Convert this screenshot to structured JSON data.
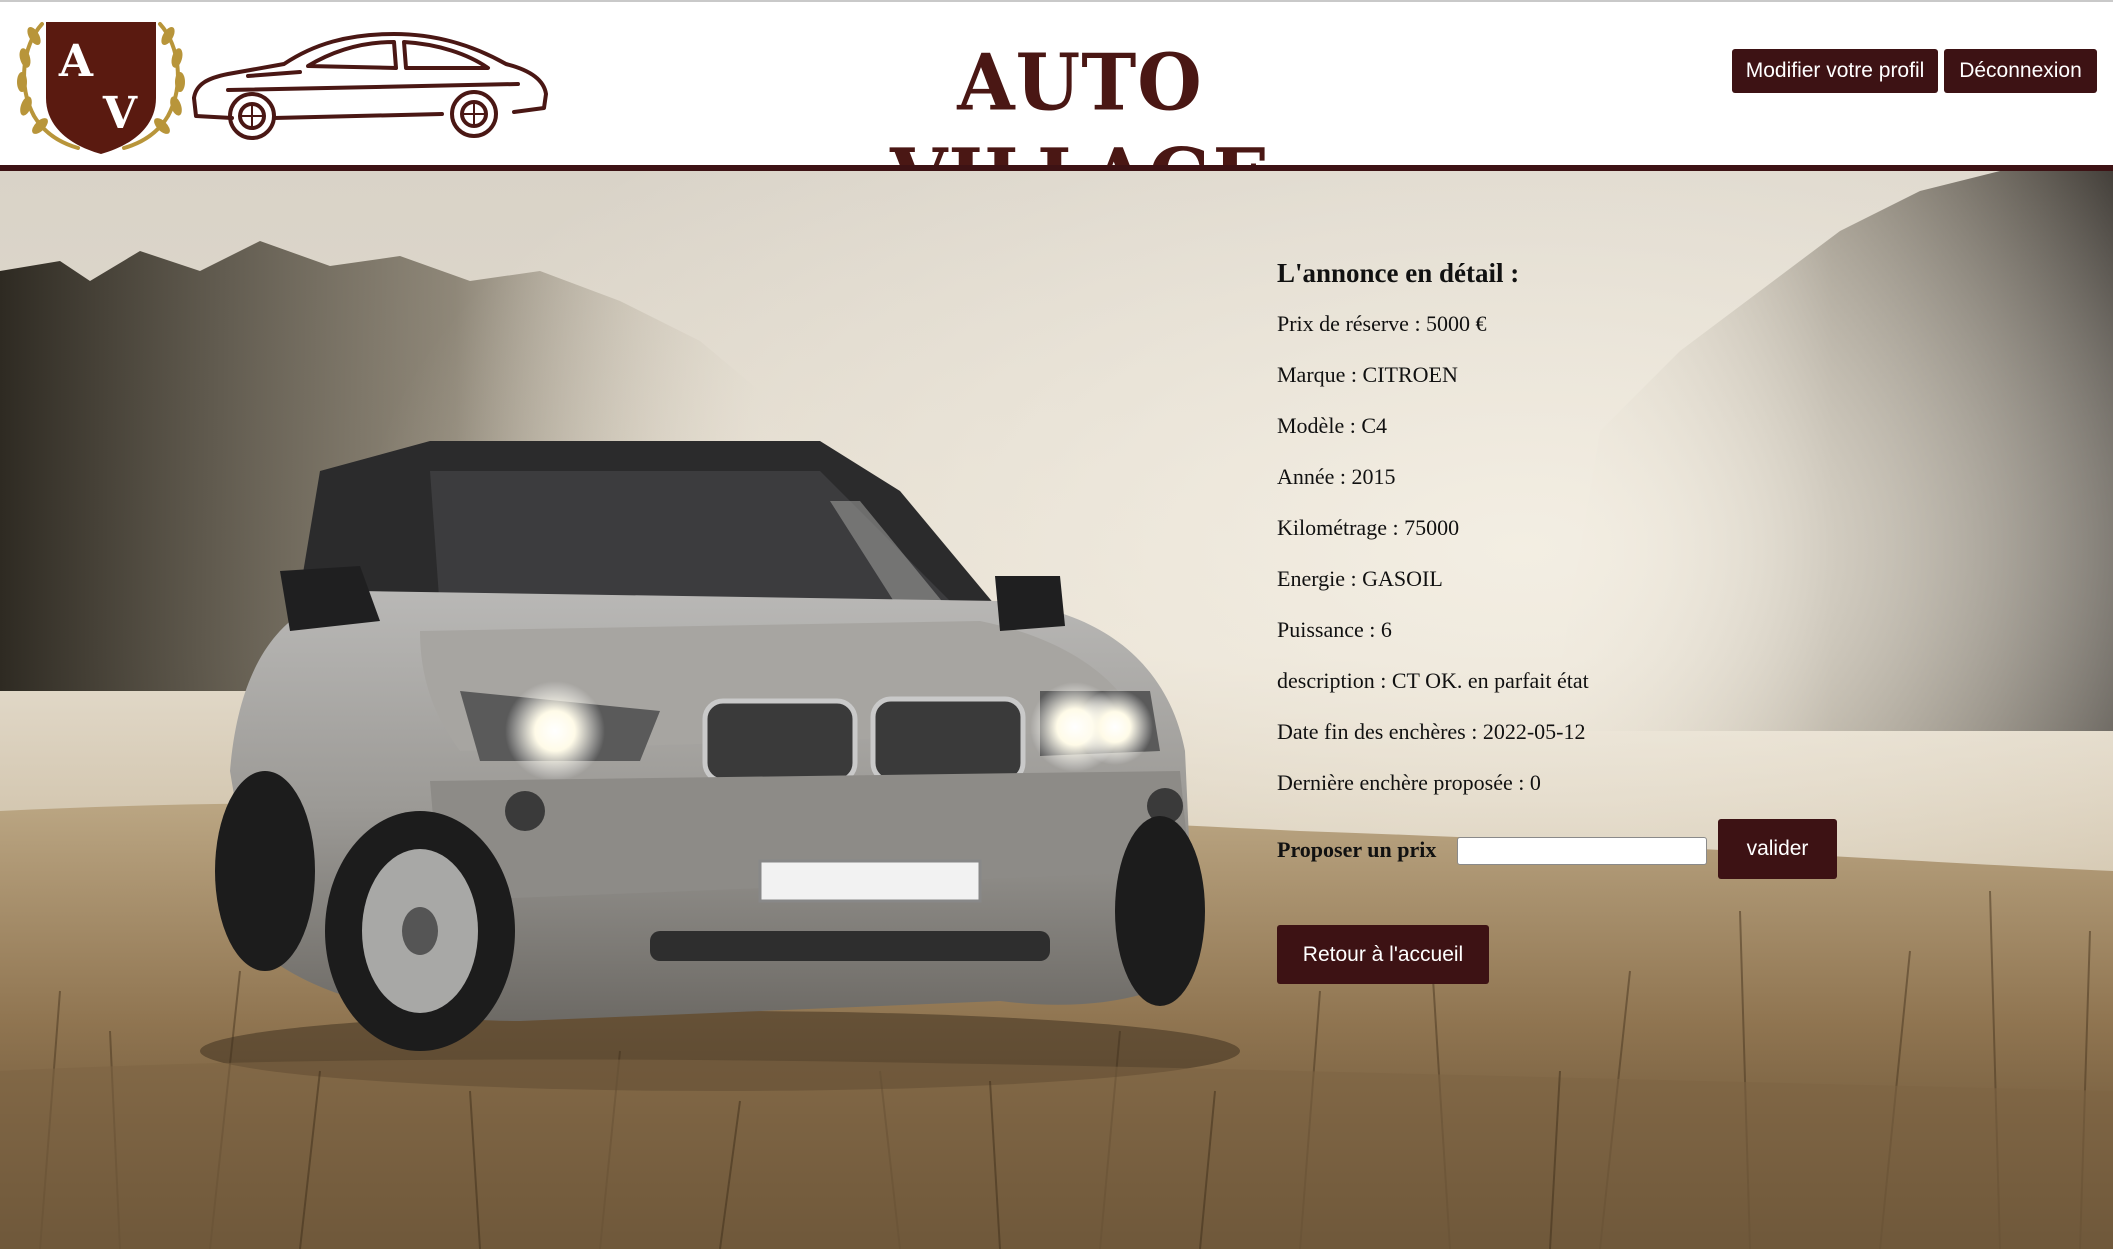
{
  "header": {
    "brand_title": "AUTO VILLAGE",
    "logo_letters": [
      "A",
      "V"
    ],
    "profile_button": "Modifier votre profil",
    "logout_button": "Déconnexion"
  },
  "listing": {
    "heading": "L'annonce en détail :",
    "rows": [
      "Prix de réserve : 5000 €",
      "Marque : CITROEN",
      "Modèle : C4",
      "Année : 2015",
      "Kilométrage : 75000",
      "Energie : GASOIL",
      "Puissance : 6",
      "description : CT OK. en parfait état",
      "Date fin des enchères : 2022-05-12",
      "Dernière enchère proposée : 0"
    ],
    "offer_label": "Proposer un prix",
    "offer_input_value": "",
    "submit_button": "valider",
    "home_button": "Retour à l'accueil"
  },
  "colors": {
    "brand": "#3d1214",
    "title": "#4a1714",
    "crest_gold": "#b8953a"
  },
  "icons": {
    "logo_crest": "shield-laurel-icon",
    "logo_car": "car-outline-icon",
    "hero": "suv-in-foggy-field-photo"
  }
}
